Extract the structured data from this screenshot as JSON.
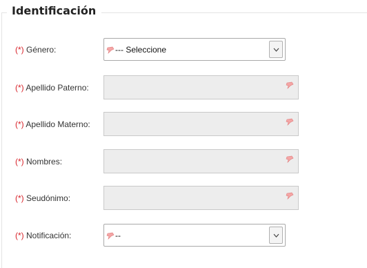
{
  "section": {
    "legend": "Identificación"
  },
  "required_marker": "(*)",
  "fields": {
    "genero": {
      "label": "Género:",
      "value": "--- Seleccione"
    },
    "apellido_paterno": {
      "label": "Apellido Paterno:",
      "value": ""
    },
    "apellido_materno": {
      "label": "Apellido Materno:",
      "value": ""
    },
    "nombres": {
      "label": "Nombres:",
      "value": ""
    },
    "seudonimo": {
      "label": "Seudónimo:",
      "value": ""
    },
    "notificacion": {
      "label": "Notificación:",
      "value": "--"
    }
  },
  "icons": {
    "field_marker": "pin-icon",
    "dropdown": "chevron-down-icon"
  },
  "colors": {
    "required": "#d8232a",
    "input_bg": "#ededed",
    "pin": "#f08a8a"
  }
}
